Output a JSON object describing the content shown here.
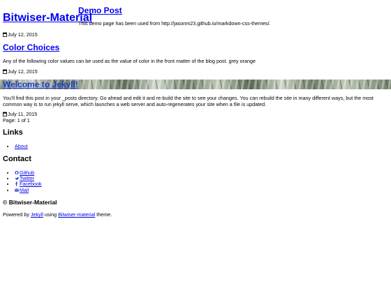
{
  "site": {
    "title": "Bitwiser-Material"
  },
  "posts": [
    {
      "title": "Demo Post",
      "excerpt": "This demo page has been used from http://jasonm23.github.io/markdown-css-themes/.",
      "date": "July 12, 2015"
    },
    {
      "title": "Color Choices",
      "excerpt": "Any of the following color values can be used as the value of color in the front matter of the blog post. grey orange",
      "date": "July 12, 2015"
    },
    {
      "title": "Welcome to Jekyll!",
      "excerpt": "You’ll find this post in your _posts directory. Go ahead and edit it and re-build the site to see your changes. You can rebuild the site in many different ways, but the most common way is to run jekyll serve, which launches a web server and auto-regenerates your site when a file is updated.",
      "date": "July 11, 2015"
    }
  ],
  "pagination": {
    "text": "Page: 1 of 1"
  },
  "links": {
    "heading": "Links",
    "items": [
      {
        "label": "About"
      }
    ]
  },
  "contact": {
    "heading": "Contact",
    "items": [
      {
        "label": "Github",
        "icon": "github-icon"
      },
      {
        "label": "Twitter",
        "icon": "twitter-icon"
      },
      {
        "label": "Facebook",
        "icon": "facebook-icon"
      },
      {
        "label": "Mail",
        "icon": "mail-icon"
      }
    ]
  },
  "footer": {
    "title": "© Bitwiser-Material",
    "powered_prefix": "Powered by ",
    "jekyll_link": "Jekyll",
    "using_text": " using ",
    "theme_link": "Bitwiser-material",
    "suffix": " theme."
  }
}
